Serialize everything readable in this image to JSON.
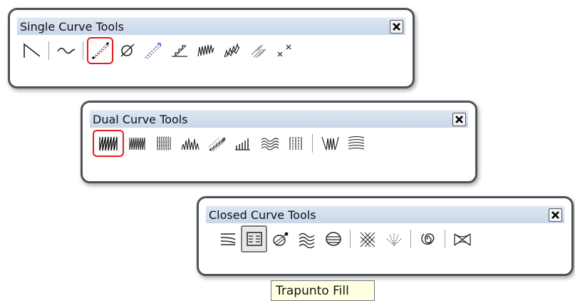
{
  "single": {
    "title": "Single Curve Tools",
    "close_label": "close",
    "tools": [
      {
        "icon": "polyline-corner-icon"
      },
      {
        "icon": "wave-line-icon"
      },
      {
        "icon": "diagonal-dotted-red-icon",
        "selected": true
      },
      {
        "icon": "circle-slash-icon"
      },
      {
        "icon": "diagonal-dotted-blue-icon"
      },
      {
        "icon": "zigzag-steps-icon"
      },
      {
        "icon": "sawtooth-wave-icon"
      },
      {
        "icon": "arrow-zigzag-icon"
      },
      {
        "icon": "hatch-diagonal-icon"
      },
      {
        "icon": "cross-marks-icon"
      }
    ]
  },
  "dual": {
    "title": "Dual Curve Tools",
    "tools": [
      {
        "icon": "satin-zigzag-icon",
        "selected": true
      },
      {
        "icon": "satin-narrow-icon"
      },
      {
        "icon": "satin-blocks-icon"
      },
      {
        "icon": "satin-uneven-icon"
      },
      {
        "icon": "satin-diagonal-fill-icon"
      },
      {
        "icon": "satin-bars-icon"
      },
      {
        "icon": "wave-bands-icon"
      },
      {
        "icon": "vertical-columns-icon"
      },
      {
        "icon": "curved-satin-icon"
      },
      {
        "icon": "curved-stripes-icon"
      }
    ]
  },
  "closed": {
    "title": "Closed Curve Tools",
    "tools": [
      {
        "icon": "line-fill-icon"
      },
      {
        "icon": "trapunto-fill-icon",
        "pressed": true
      },
      {
        "icon": "circle-fill-icon"
      },
      {
        "icon": "wave-fill-icon"
      },
      {
        "icon": "ring-fill-icon"
      },
      {
        "icon": "crosshatch-fill-icon"
      },
      {
        "icon": "radial-fill-icon"
      },
      {
        "icon": "spiral-fill-icon"
      },
      {
        "icon": "web-fill-icon"
      }
    ]
  },
  "tooltip": {
    "text": "Trapunto Fill"
  },
  "colors": {
    "selected_border": "#e31c1c",
    "frame": "#4e5258",
    "titlebar": "#c8d7e9",
    "tooltip_bg": "#ffffe1"
  }
}
